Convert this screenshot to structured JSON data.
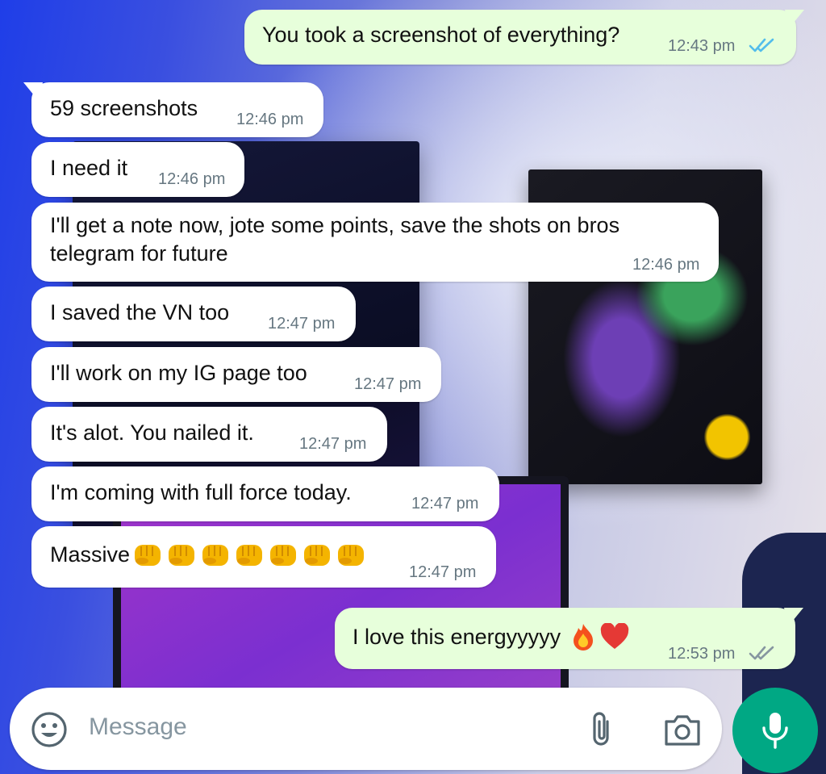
{
  "messages": [
    {
      "dir": "out",
      "text": "You took a screenshot of everything?",
      "time": "12:43 pm",
      "status": "read"
    },
    {
      "dir": "in",
      "text": "59 screenshots",
      "time": "12:46 pm"
    },
    {
      "dir": "in",
      "text": "I need it",
      "time": "12:46 pm"
    },
    {
      "dir": "in",
      "text": "I'll get a note now, jote some points, save the shots on bros telegram for future",
      "time": "12:46 pm"
    },
    {
      "dir": "in",
      "text": "I saved the VN too",
      "time": "12:47 pm"
    },
    {
      "dir": "in",
      "text": "I'll work on my IG page too",
      "time": "12:47 pm"
    },
    {
      "dir": "in",
      "text": "It's alot. You nailed it.",
      "time": "12:47 pm"
    },
    {
      "dir": "in",
      "text": "I'm coming with full force today.",
      "time": "12:47 pm"
    },
    {
      "dir": "in",
      "text": "Massive",
      "emoji": "fist-emoji x7",
      "time": "12:47 pm"
    },
    {
      "dir": "out",
      "text": "I love this energyyyyy",
      "emoji": "fire-emoji heart-emoji",
      "time": "12:53 pm",
      "status": "delivered"
    }
  ],
  "composer": {
    "placeholder": "Message",
    "icons": [
      "smiley-icon",
      "attach-icon",
      "camera-icon",
      "mic-icon"
    ]
  },
  "colors": {
    "incoming_bubble": "#ffffff",
    "outgoing_bubble": "#e7ffdb",
    "timestamp": "#667781",
    "read_ticks": "#53bdeb",
    "delivered_ticks": "#8696a0",
    "mic_button": "#00a884"
  }
}
